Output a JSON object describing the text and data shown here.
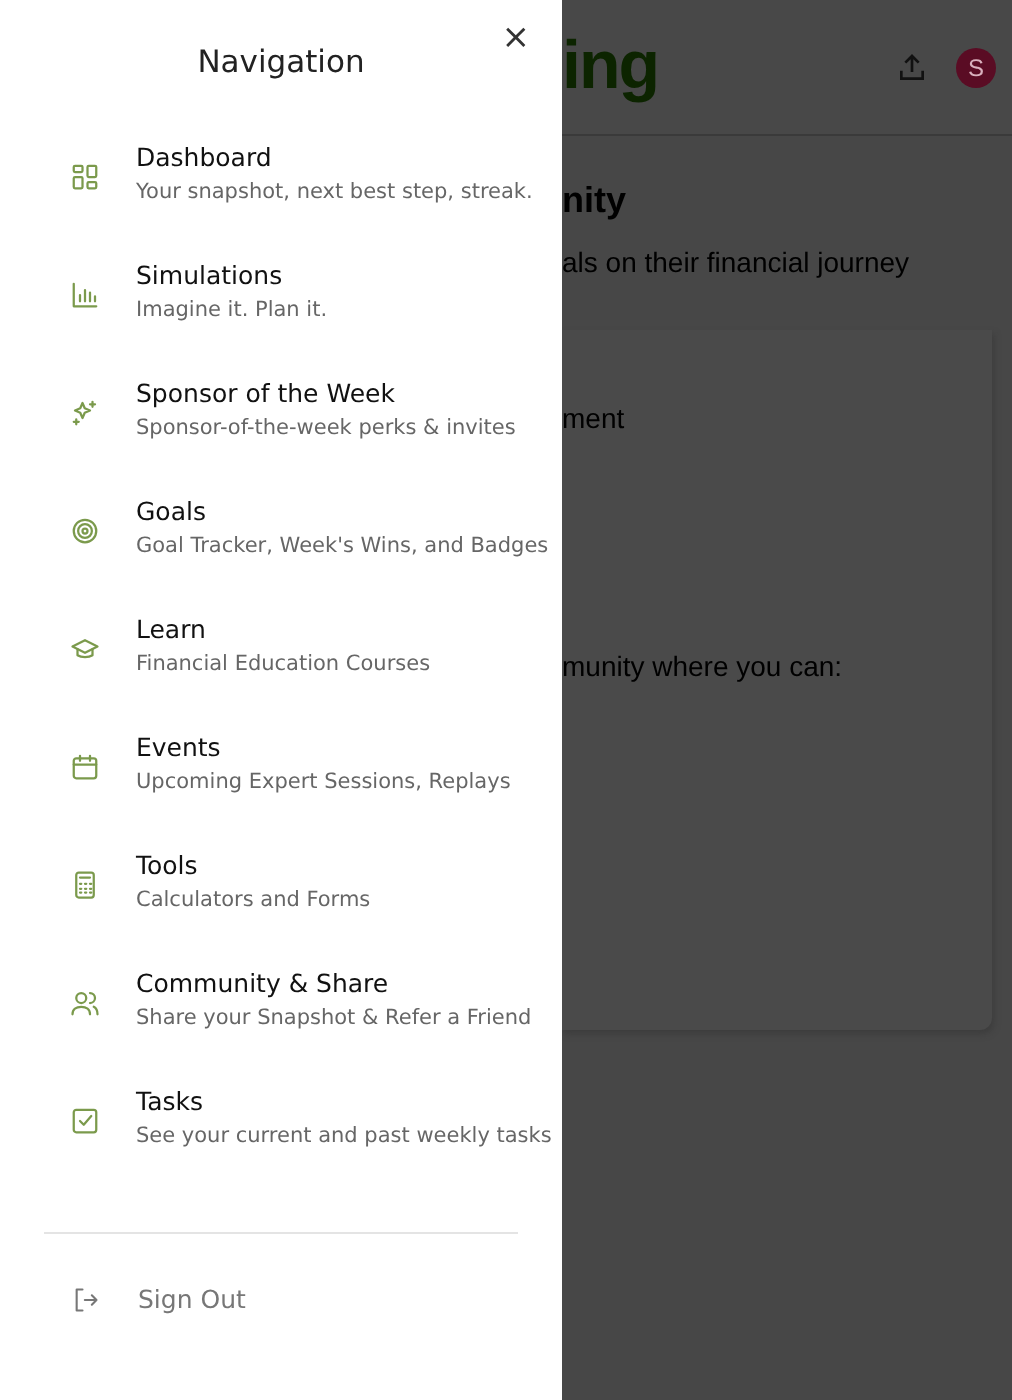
{
  "background_page": {
    "logo": "ing",
    "avatar": "S",
    "heading": "nity",
    "subtitle": "als on their financial journey",
    "card_lines": [
      "ment",
      "munity where you can:"
    ]
  },
  "drawer": {
    "title": "Navigation",
    "close": "×",
    "items": [
      {
        "title": "Dashboard",
        "subtitle": "Your snapshot, next best step, streak."
      },
      {
        "title": "Simulations",
        "subtitle": "Imagine it. Plan it."
      },
      {
        "title": "Sponsor of the Week",
        "subtitle": "Sponsor-of-the-week perks & invites"
      },
      {
        "title": "Goals",
        "subtitle": "Goal Tracker, Week's Wins, and Badges"
      },
      {
        "title": "Learn",
        "subtitle": "Financial Education Courses"
      },
      {
        "title": "Events",
        "subtitle": "Upcoming Expert Sessions, Replays"
      },
      {
        "title": "Tools",
        "subtitle": "Calculators and Forms"
      },
      {
        "title": "Community & Share",
        "subtitle": "Share your Snapshot & Refer a Friend"
      },
      {
        "title": "Tasks",
        "subtitle": "See your current and past weekly tasks"
      }
    ],
    "sign_out": "Sign Out"
  }
}
